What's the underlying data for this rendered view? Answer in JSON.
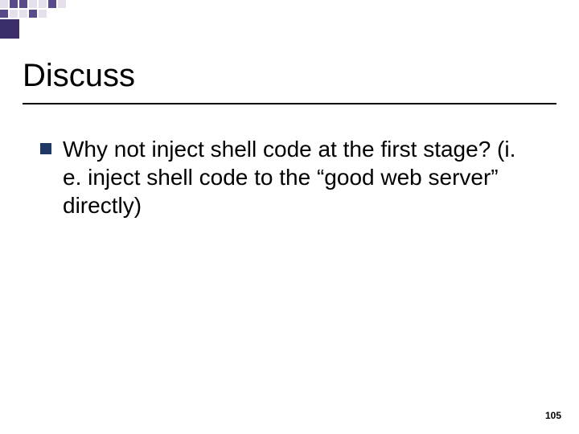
{
  "slide": {
    "title": "Discuss",
    "bullets": [
      "Why not inject shell code at the first stage? (i. e. inject shell code to the “good web server” directly)"
    ],
    "page_number": "105"
  }
}
